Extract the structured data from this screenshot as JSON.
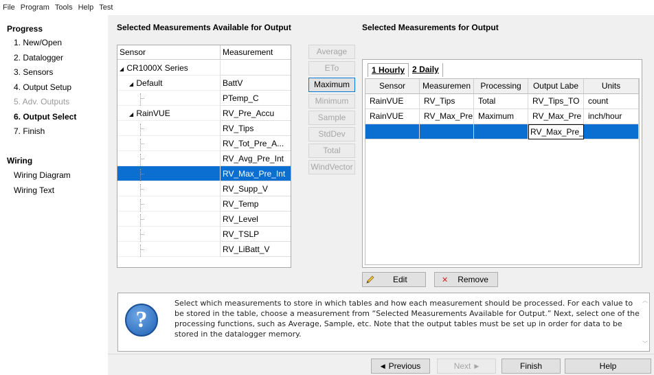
{
  "menu": [
    "File",
    "Program",
    "Tools",
    "Help",
    "Test"
  ],
  "sidebar": {
    "progress_title": "Progress",
    "steps": [
      {
        "label": "1. New/Open",
        "state": "normal"
      },
      {
        "label": "2. Datalogger",
        "state": "normal"
      },
      {
        "label": "3. Sensors",
        "state": "normal"
      },
      {
        "label": "4. Output Setup",
        "state": "normal"
      },
      {
        "label": "5. Adv. Outputs",
        "state": "disabled"
      },
      {
        "label": "6. Output Select",
        "state": "active"
      },
      {
        "label": "7. Finish",
        "state": "normal"
      }
    ],
    "wiring_title": "Wiring",
    "wiring_items": [
      "Wiring Diagram",
      "Wiring Text"
    ]
  },
  "available": {
    "title": "Selected Measurements Available for Output",
    "columns": [
      "Sensor",
      "Measurement"
    ],
    "rows": [
      {
        "sensor": "CR1000X Series",
        "level": 0,
        "expander": "◢",
        "measurement": ""
      },
      {
        "sensor": "Default",
        "level": 1,
        "expander": "◢",
        "measurement": "BattV"
      },
      {
        "sensor": "",
        "level": 2,
        "measurement": "PTemp_C"
      },
      {
        "sensor": "RainVUE",
        "level": 1,
        "expander": "◢",
        "measurement": "RV_Pre_Accu"
      },
      {
        "sensor": "",
        "level": 2,
        "measurement": "RV_Tips"
      },
      {
        "sensor": "",
        "level": 2,
        "measurement": "RV_Tot_Pre_A..."
      },
      {
        "sensor": "",
        "level": 2,
        "measurement": "RV_Avg_Pre_Int"
      },
      {
        "sensor": "",
        "level": 2,
        "measurement": "RV_Max_Pre_Int",
        "selected": true
      },
      {
        "sensor": "",
        "level": 2,
        "measurement": "RV_Supp_V"
      },
      {
        "sensor": "",
        "level": 2,
        "measurement": "RV_Temp"
      },
      {
        "sensor": "",
        "level": 2,
        "measurement": "RV_Level"
      },
      {
        "sensor": "",
        "level": 2,
        "measurement": "RV_TSLP"
      },
      {
        "sensor": "",
        "level": 2,
        "measurement": "RV_LiBatt_V"
      }
    ]
  },
  "functions": [
    {
      "label": "Average",
      "enabled": false
    },
    {
      "label": "ETo",
      "enabled": false
    },
    {
      "label": "Maximum",
      "enabled": true
    },
    {
      "label": "Minimum",
      "enabled": false
    },
    {
      "label": "Sample",
      "enabled": false
    },
    {
      "label": "StdDev",
      "enabled": false
    },
    {
      "label": "Total",
      "enabled": false
    },
    {
      "label": "WindVector",
      "enabled": false
    }
  ],
  "output": {
    "title": "Selected Measurements for Output",
    "tabs": [
      {
        "num": "1",
        "label": "Hourly",
        "active": true
      },
      {
        "num": "2",
        "label": "Daily",
        "active": false
      }
    ],
    "columns": [
      "Sensor",
      "Measuremen",
      "Processing",
      "Output Labe",
      "Units"
    ],
    "rows": [
      [
        "RainVUE",
        "RV_Tips",
        "Total",
        "RV_Tips_TO",
        "count"
      ],
      [
        "RainVUE",
        "RV_Max_Pre",
        "Maximum",
        "RV_Max_Pre",
        "inch/hour"
      ],
      [
        "",
        "",
        "",
        "RV_Max_Pre_",
        ""
      ]
    ],
    "edit_label": "Edit",
    "remove_label": "Remove"
  },
  "help_text": "Select which measurements to store in which tables and how each measurement should be processed. For each value to be stored in the table, choose a measurement from “Selected Measurements Available for Output.” Next, select one of the processing functions, such as Average, Sample, etc. Note that the output tables must be set up in order for data to be stored in the datalogger memory.",
  "nav": {
    "previous": "Previous",
    "next": "Next",
    "finish": "Finish",
    "help": "Help"
  },
  "colors": {
    "selection": "#0a6fd0",
    "help_icon": "#1d5fb3"
  },
  "icons": {
    "edit": "pencil-icon",
    "remove": "red-x-icon",
    "help": "question-mark-icon"
  }
}
